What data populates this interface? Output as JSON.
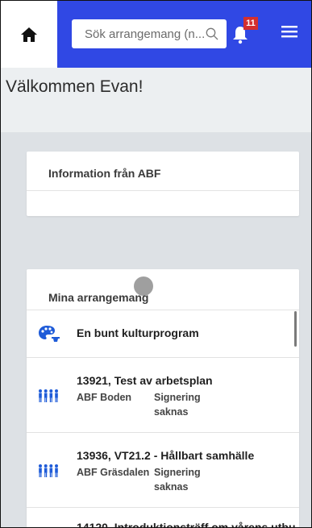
{
  "search": {
    "placeholder": "Sök arrangemang (n..."
  },
  "notifications": {
    "count": "11"
  },
  "welcome": {
    "text": "Välkommen Evan!"
  },
  "info_card": {
    "title": "Information från ABF"
  },
  "events_card": {
    "title": "Mina arrangemang",
    "items": [
      {
        "title": "En bunt kulturprogram",
        "icon": "culture-palette-icon"
      },
      {
        "title": "13921, Test av arbetsplan",
        "org": "ABF Boden",
        "status": "Signering saknas",
        "icon": "study-circle-icon"
      },
      {
        "title": "13936, VT21.2 - Hållbart samhälle",
        "org": "ABF Gräsdalen",
        "status": "Signering saknas",
        "icon": "study-circle-icon"
      },
      {
        "title": "14120, Introduktionsträff om vårens utbu",
        "icon": "study-circle-icon"
      }
    ]
  },
  "colors": {
    "topbar": "#3048e4",
    "badge": "#d32f2f",
    "icon_blue": "#1e5bd8"
  }
}
